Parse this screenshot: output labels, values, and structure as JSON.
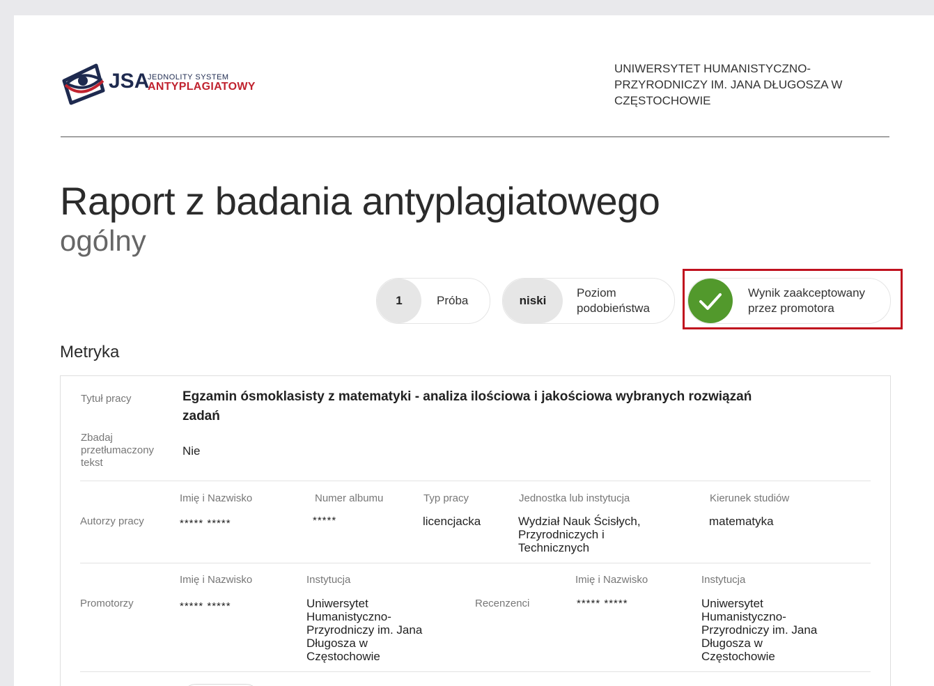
{
  "header": {
    "logo": {
      "short": "JSA",
      "line1": "JEDNOLITY SYSTEM",
      "line2": "ANTYPLAGIATOWY",
      "icon": "eye-logo-icon"
    },
    "university": "UNIWERSYTET HUMANISTYCZNO-PRZYRODNICZY IM. JANA DŁUGOSZA W CZĘSTOCHOWIE"
  },
  "report": {
    "title": "Raport z badania antyplagiatowego",
    "subtitle": "ogólny"
  },
  "badges": {
    "attempt": {
      "value": "1",
      "label": "Próba"
    },
    "similarity": {
      "value": "niski",
      "label": "Poziom podobieństwa"
    },
    "result": {
      "icon": "checkmark-icon",
      "label": "Wynik zaakceptowany przez promotora",
      "color": "#52992c"
    }
  },
  "highlight_color": "#c0111e",
  "metrics": {
    "section_title": "Metryka",
    "title_label": "Tytuł pracy",
    "title_value": "Egzamin ósmoklasisty z matematyki - analiza ilościowa i jakościowa wybranych rozwiązań zadań",
    "translated_label": "Zbadaj przetłumaczony tekst",
    "translated_value": "Nie",
    "authors": {
      "label": "Autorzy pracy",
      "headers": [
        "Imię i Nazwisko",
        "Numer albumu",
        "Typ pracy",
        "Jednostka lub instytucja",
        "Kierunek studiów"
      ],
      "values": [
        "***** *****",
        "*****",
        "licencjacka",
        "Wydział Nauk Ścisłych, Przyrodniczych i Technicznych",
        "matematyka"
      ]
    },
    "supervisors": {
      "label": "Promotorzy",
      "headers": [
        "Imię i Nazwisko",
        "Instytucja"
      ],
      "values": [
        "***** *****",
        "Uniwersytet Humanistyczno-Przyrodniczy im. Jana Długosza w Częstochowie"
      ]
    },
    "reviewers": {
      "label": "Recenzenci",
      "headers": [
        "Imię i Nazwisko",
        "Instytucja"
      ],
      "values": [
        "***** *****",
        "Uniwersytet Humanistyczno-Przyrodniczy im. Jana Długosza w Częstochowie"
      ]
    }
  }
}
